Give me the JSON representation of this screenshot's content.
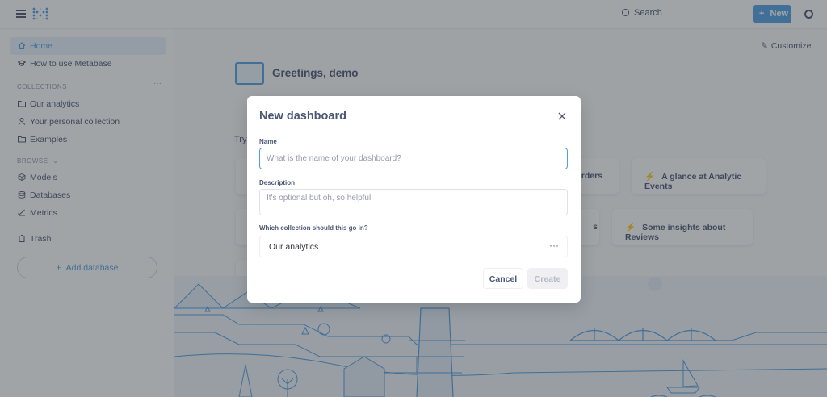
{
  "topbar": {
    "search_label": "Search",
    "new_label": "New",
    "new_plus": "+"
  },
  "sidebar": {
    "items_top": [
      {
        "label": "Home",
        "icon": "home-icon"
      },
      {
        "label": "How to use Metabase",
        "icon": "learn-icon"
      }
    ],
    "collections_label": "COLLECTIONS",
    "collections_more": "···",
    "collections": [
      {
        "label": "Our analytics",
        "icon": "folder-icon"
      },
      {
        "label": "Your personal collection",
        "icon": "person-icon"
      },
      {
        "label": "Examples",
        "icon": "folder-icon"
      }
    ],
    "browse_label": "BROWSE",
    "browse": [
      {
        "label": "Models",
        "icon": "model-icon"
      },
      {
        "label": "Databases",
        "icon": "database-icon"
      },
      {
        "label": "Metrics",
        "icon": "metric-icon"
      }
    ],
    "trash_label": "Trash",
    "add_database_label": "Add database",
    "add_database_plus": "+"
  },
  "main": {
    "customize_label": "Customize",
    "greeting": "Greetings, demo",
    "try_label": "Try",
    "xrays": [
      {
        "label": "Orders"
      },
      {
        "label": "A glance at Analytic Events"
      },
      {
        "label": "s"
      },
      {
        "label": "Some insights about Reviews"
      }
    ]
  },
  "modal": {
    "title": "New dashboard",
    "name_label": "Name",
    "name_placeholder": "What is the name of your dashboard?",
    "name_value": "",
    "description_label": "Description",
    "description_placeholder": "It's optional but oh, so helpful",
    "collection_label": "Which collection should this go in?",
    "collection_value": "Our analytics",
    "collection_more": "···",
    "cancel_label": "Cancel",
    "create_label": "Create"
  },
  "colors": {
    "brand": "#509ee3",
    "text": "#4c5773",
    "muted": "#949aab"
  }
}
